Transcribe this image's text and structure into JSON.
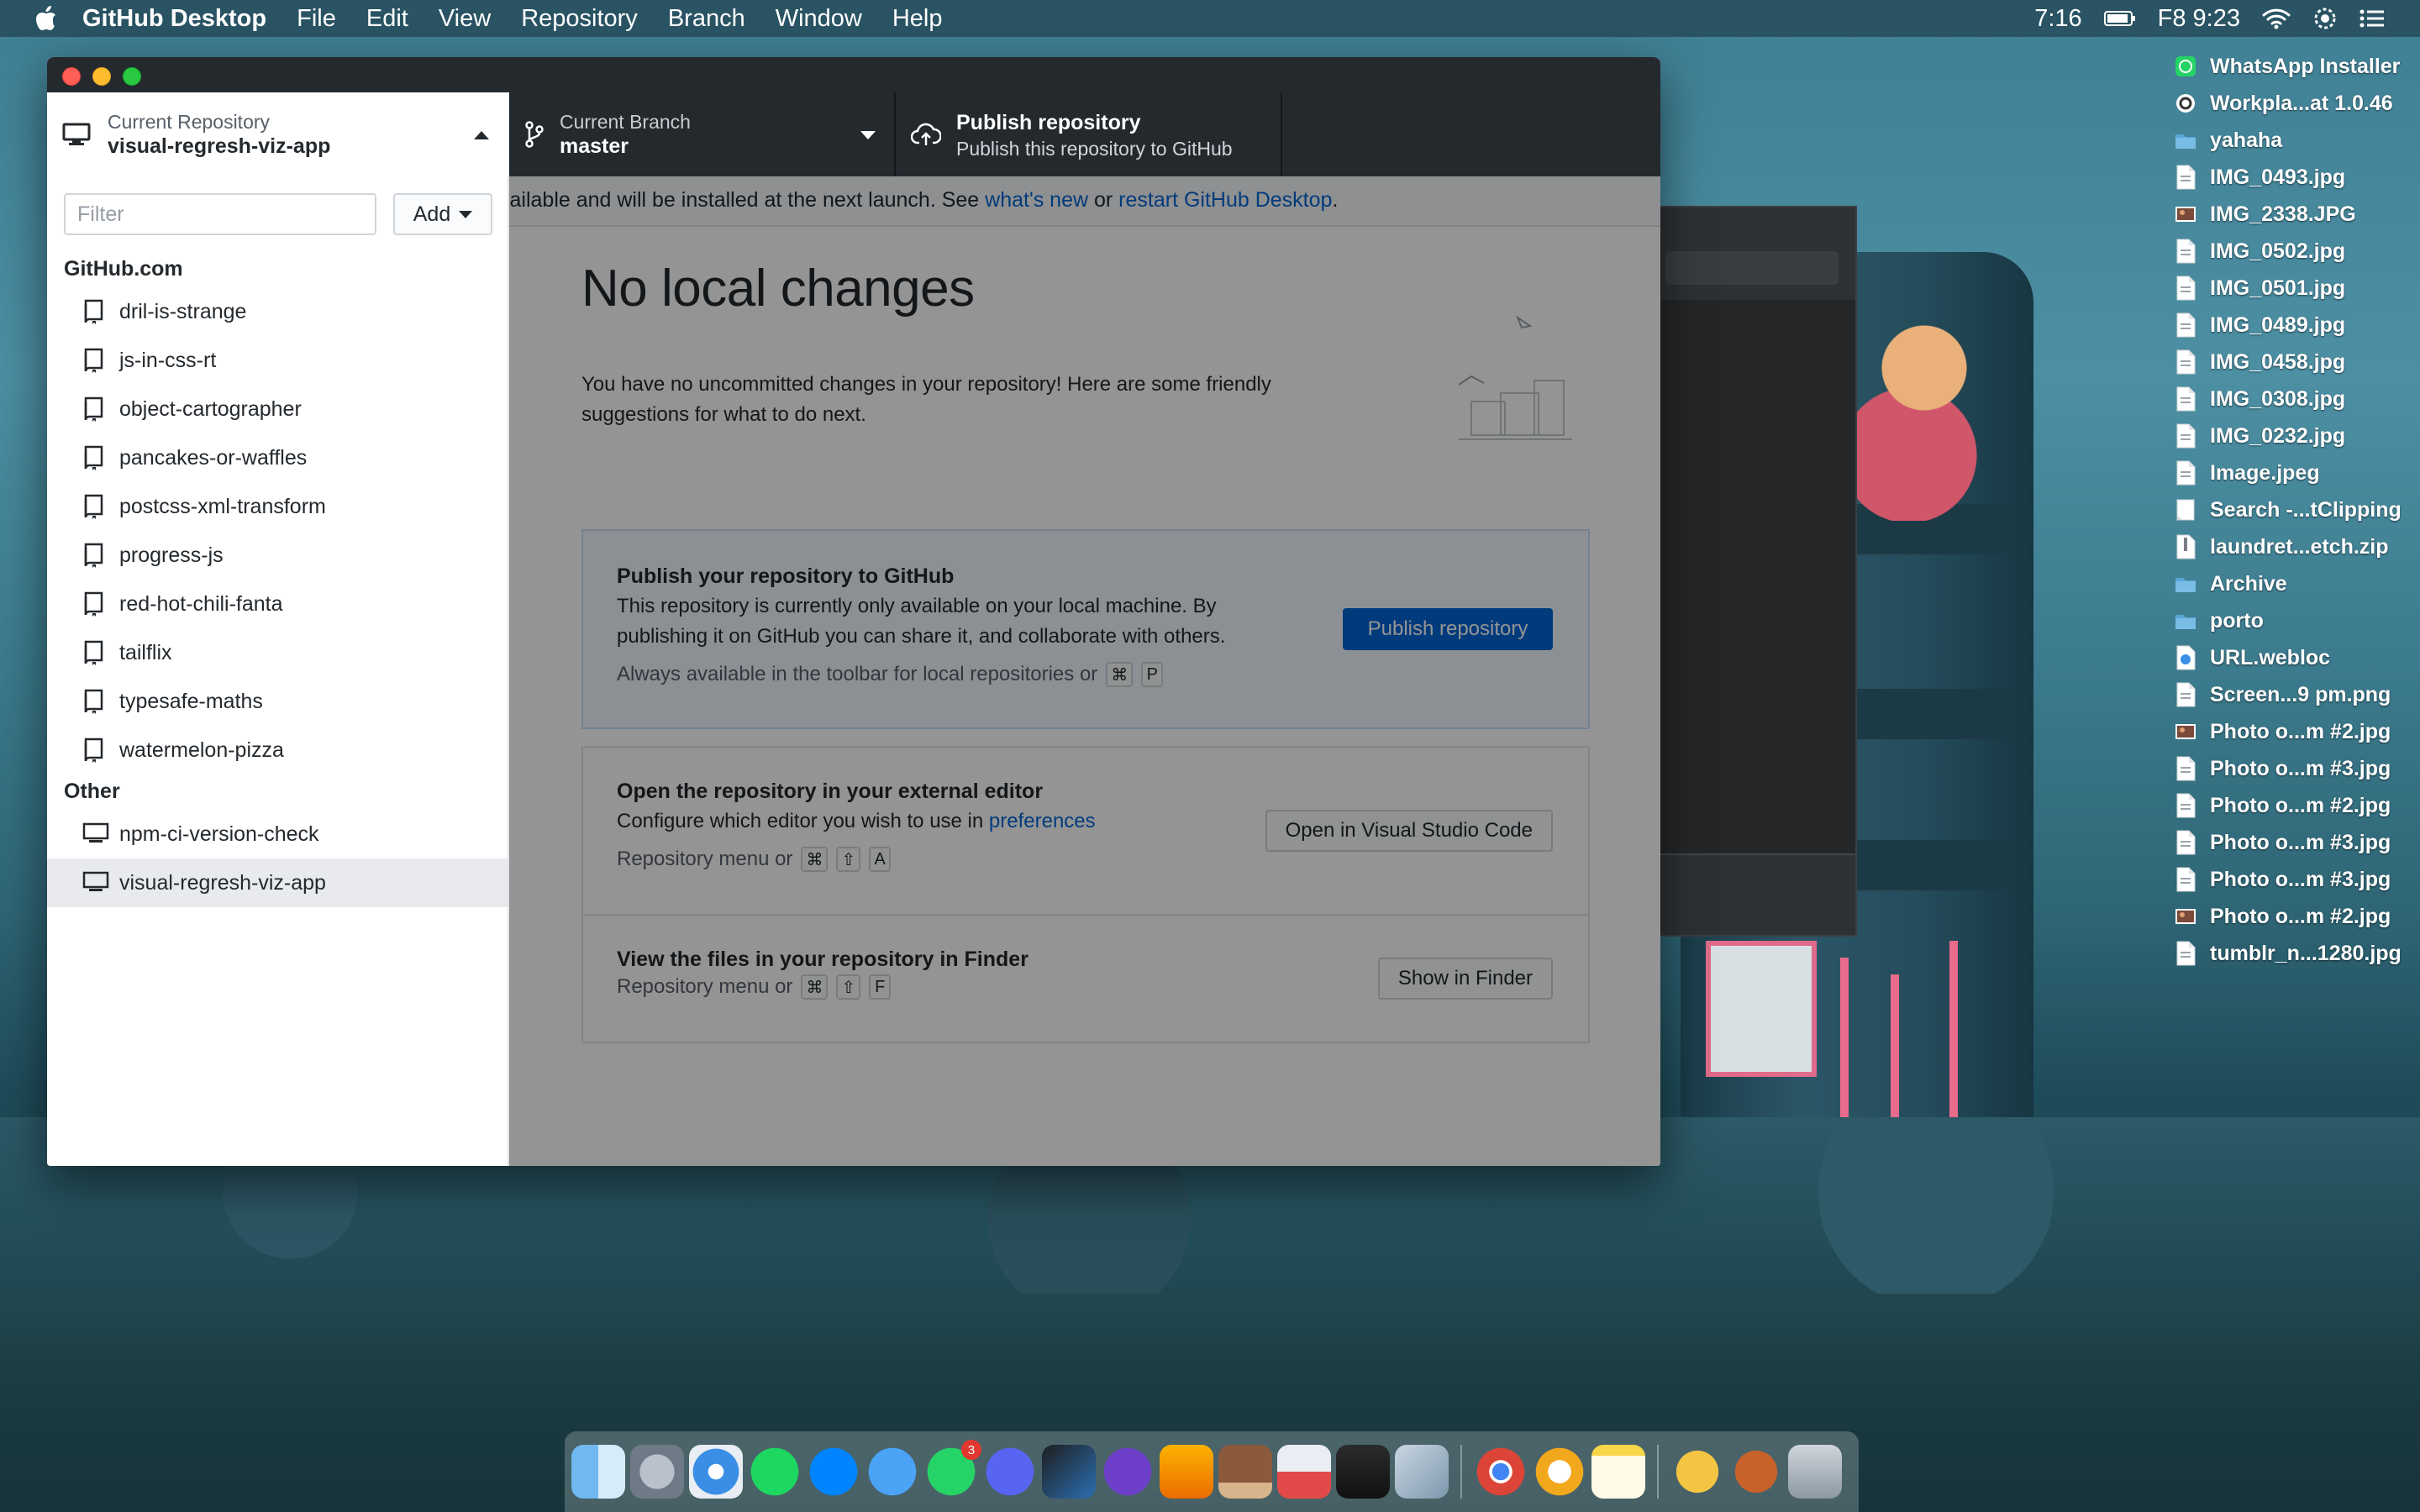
{
  "menubar": {
    "app_name": "GitHub Desktop",
    "items": [
      "File",
      "Edit",
      "View",
      "Repository",
      "Branch",
      "Window",
      "Help"
    ],
    "clock_time": "7:16",
    "date_time": "F8 9:23"
  },
  "desktop_icons": [
    {
      "label": "WhatsApp Installer",
      "icon": "whatsapp-file-icon"
    },
    {
      "label": "Workpla...at 1.0.46",
      "icon": "workplace-file-icon"
    },
    {
      "label": "yahaha",
      "icon": "folder-icon"
    },
    {
      "label": "IMG_0493.jpg",
      "icon": "image-file-icon"
    },
    {
      "label": "IMG_2338.JPG",
      "icon": "photo-thumbnail-icon"
    },
    {
      "label": "IMG_0502.jpg",
      "icon": "image-file-icon"
    },
    {
      "label": "IMG_0501.jpg",
      "icon": "image-file-icon"
    },
    {
      "label": "IMG_0489.jpg",
      "icon": "image-file-icon"
    },
    {
      "label": "IMG_0458.jpg",
      "icon": "image-file-icon"
    },
    {
      "label": "IMG_0308.jpg",
      "icon": "image-file-icon"
    },
    {
      "label": "IMG_0232.jpg",
      "icon": "image-file-icon"
    },
    {
      "label": "Image.jpeg",
      "icon": "image-file-icon"
    },
    {
      "label": "Search -...tClipping",
      "icon": "text-clipping-icon"
    },
    {
      "label": "laundret...etch.zip",
      "icon": "zip-file-icon"
    },
    {
      "label": "Archive",
      "icon": "folder-icon"
    },
    {
      "label": "porto",
      "icon": "folder-icon"
    },
    {
      "label": "URL.webloc",
      "icon": "webloc-file-icon"
    },
    {
      "label": "Screen...9 pm.png",
      "icon": "image-file-icon"
    },
    {
      "label": "Photo o...m #2.jpg",
      "icon": "photo-thumbnail-icon"
    },
    {
      "label": "Photo o...m #3.jpg",
      "icon": "image-file-icon"
    },
    {
      "label": "Photo o...m #2.jpg",
      "icon": "image-file-icon"
    },
    {
      "label": "Photo o...m #3.jpg",
      "icon": "image-file-icon"
    },
    {
      "label": "Photo o...m #3.jpg",
      "icon": "image-file-icon"
    },
    {
      "label": "Photo o...m #2.jpg",
      "icon": "photo-thumbnail-icon"
    },
    {
      "label": "tumblr_n...1280.jpg",
      "icon": "image-file-icon"
    }
  ],
  "toolbar": {
    "repo_caption": "Current Repository",
    "repo_name": "visual-regresh-viz-app",
    "branch_caption": "Current Branch",
    "branch_name": "master",
    "publish_title": "Publish repository",
    "publish_desc": "Publish this repository to GitHub"
  },
  "sidebar": {
    "filter_placeholder": "Filter",
    "add_label": "Add",
    "groups": [
      {
        "title": "GitHub.com",
        "repos": [
          "dril-is-strange",
          "js-in-css-rt",
          "object-cartographer",
          "pancakes-or-waffles",
          "postcss-xml-transform",
          "progress-js",
          "red-hot-chili-fanta",
          "tailflix",
          "typesafe-maths",
          "watermelon-pizza"
        ]
      },
      {
        "title": "Other",
        "repos": [
          "npm-ci-version-check",
          "visual-regresh-viz-app"
        ]
      }
    ],
    "selected_repo": "visual-regresh-viz-app"
  },
  "banner": {
    "text_before": "vailable and will be installed at the next launch. See ",
    "link_whats_new": "what's new",
    "text_mid": " or ",
    "link_restart": "restart GitHub Desktop",
    "text_after": "."
  },
  "main": {
    "title": "No local changes",
    "subtitle": "You have no uncommitted changes in your repository! Here are some friendly suggestions for what to do next.",
    "publish_card": {
      "title": "Publish your repository to GitHub",
      "desc": "This repository is currently only available on your local machine. By publishing it on GitHub you can share it, and collaborate with others.",
      "hint": "Always available in the toolbar for local repositories or",
      "keys": [
        "⌘",
        "P"
      ],
      "button": "Publish repository"
    },
    "editor_card": {
      "title": "Open the repository in your external editor",
      "desc_before": "Configure which editor you wish to use in ",
      "desc_link": "preferences",
      "hint": "Repository menu or",
      "keys": [
        "⌘",
        "⇧",
        "A"
      ],
      "button": "Open in Visual Studio Code"
    },
    "finder_card": {
      "title": "View the files in your repository in Finder",
      "hint": "Repository menu or",
      "keys": [
        "⌘",
        "⇧",
        "F"
      ],
      "button": "Show in Finder"
    }
  },
  "dock": {
    "apps": [
      "finder-icon",
      "launchpad-icon",
      "safari-icon",
      "spotify-icon",
      "messenger-icon",
      "messages-icon",
      "whatsapp-icon",
      "discord-icon",
      "vscode-icon",
      "github-desktop-icon",
      "sketch-icon",
      "ice-cream-icon",
      "rocket-popsicle-icon",
      "terminal-icon",
      "preview-icon",
      "chrome-icon",
      "circle-app-icon",
      "notes-icon",
      "fruit-icon",
      "crash-bandicoot-icon",
      "trash-icon"
    ],
    "whatsapp_badge": "3"
  },
  "colors": {
    "toolbar_bg": "#24292e",
    "link_blue": "#0366d6",
    "menubar_bg": "#28505f"
  }
}
